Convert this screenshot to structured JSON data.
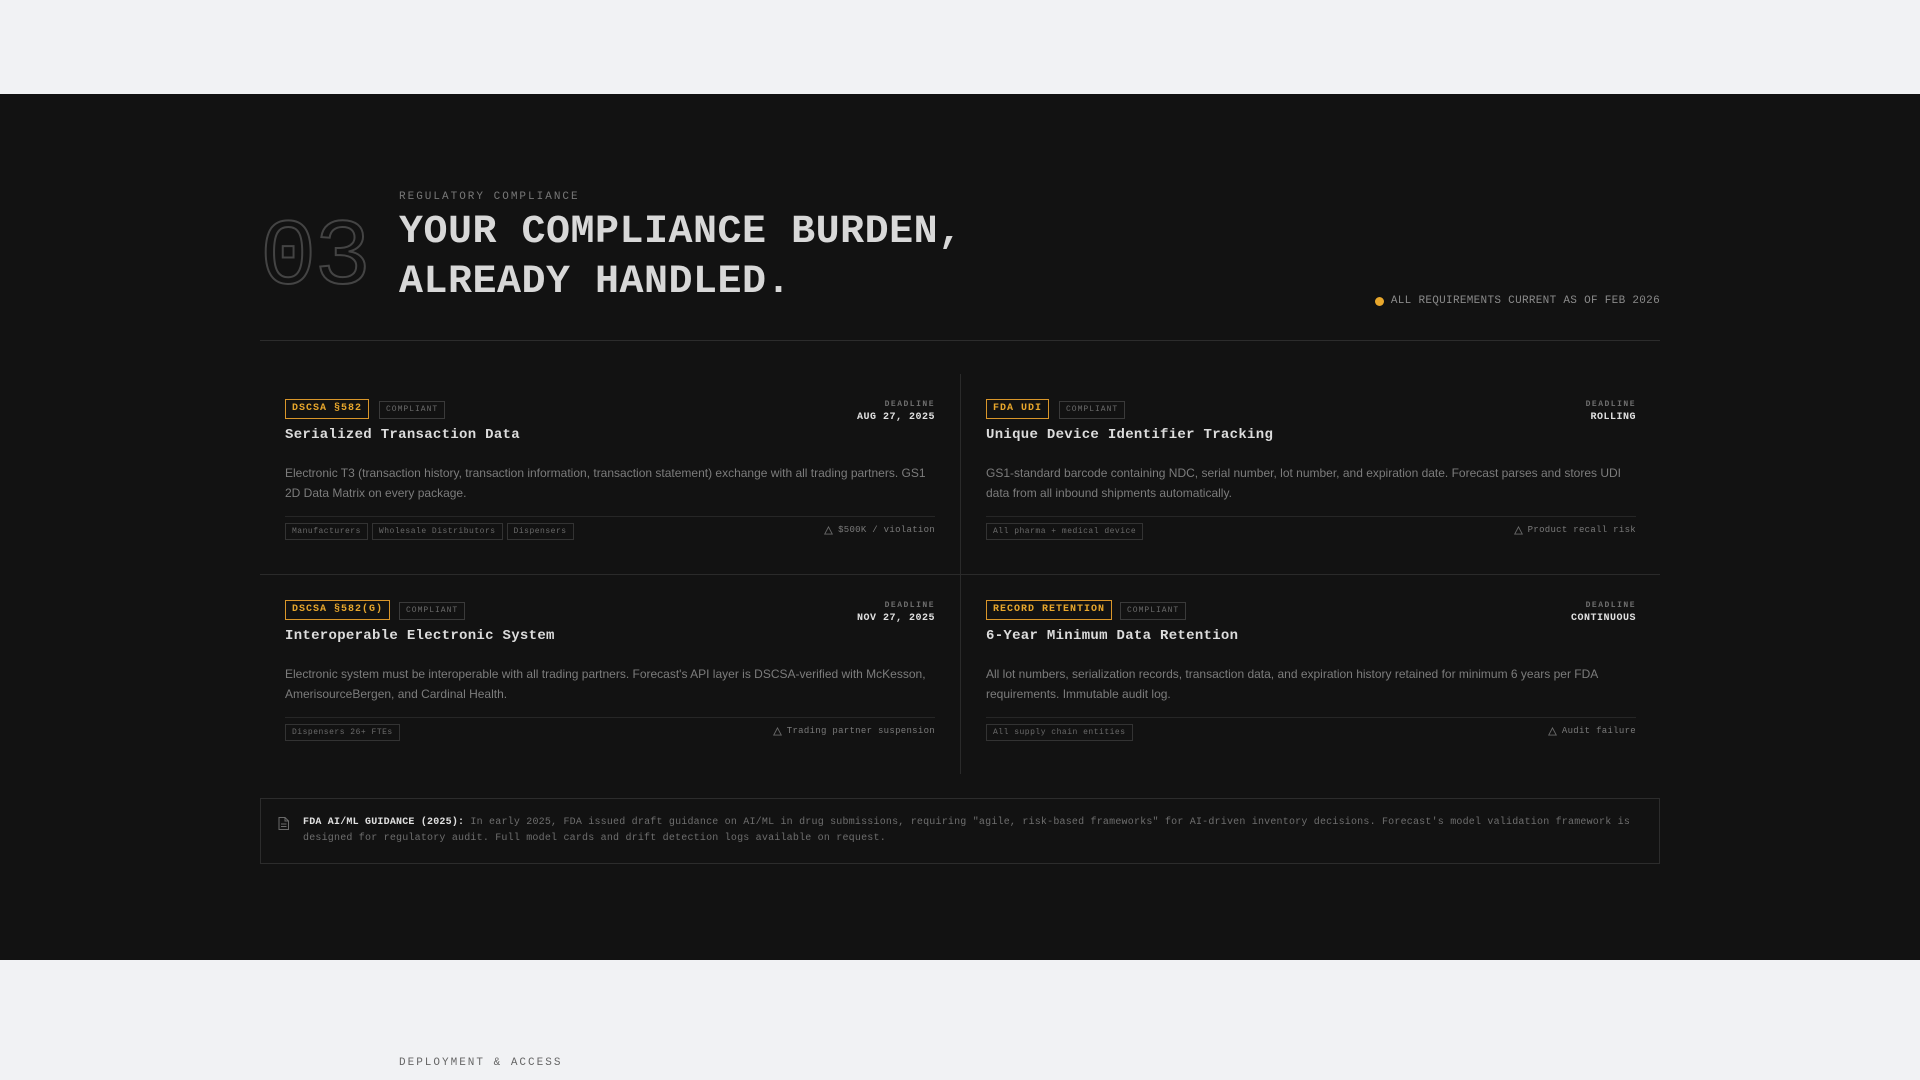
{
  "section": {
    "number": "03",
    "eyebrow": "REGULATORY COMPLIANCE",
    "headline_line1": "YOUR COMPLIANCE BURDEN,",
    "headline_line2": "ALREADY HANDLED.",
    "status_text": "ALL REQUIREMENTS CURRENT AS OF FEB 2026",
    "status_color": "#e8a72c"
  },
  "deadline_label": "DEADLINE",
  "cards": [
    {
      "code": "DSCSA §582",
      "status": "COMPLIANT",
      "deadline": "AUG 27, 2025",
      "title": "Serialized Transaction Data",
      "description": "Electronic T3 (transaction history, transaction information, transaction statement) exchange with all trading partners. GS1 2D Data Matrix on every package.",
      "chips": [
        "Manufacturers",
        "Wholesale Distributors",
        "Dispensers"
      ],
      "risk": "$500K / violation"
    },
    {
      "code": "FDA UDI",
      "status": "COMPLIANT",
      "deadline": "ROLLING",
      "title": "Unique Device Identifier Tracking",
      "description": "GS1-standard barcode containing NDC, serial number, lot number, and expiration date. Forecast parses and stores UDI data from all inbound shipments automatically.",
      "chips": [
        "All pharma + medical device"
      ],
      "risk": "Product recall risk"
    },
    {
      "code": "DSCSA §582(G)",
      "status": "COMPLIANT",
      "deadline": "NOV 27, 2025",
      "title": "Interoperable Electronic System",
      "description": "Electronic system must be interoperable with all trading partners. Forecast's API layer is DSCSA-verified with McKesson, AmerisourceBergen, and Cardinal Health.",
      "chips": [
        "Dispensers 26+ FTEs"
      ],
      "risk": "Trading partner suspension"
    },
    {
      "code": "RECORD RETENTION",
      "status": "COMPLIANT",
      "deadline": "CONTINUOUS",
      "title": "6-Year Minimum Data Retention",
      "description": "All lot numbers, serialization records, transaction data, and expiration history retained for minimum 6 years per FDA requirements. Immutable audit log.",
      "chips": [
        "All supply chain entities"
      ],
      "risk": "Audit failure"
    }
  ],
  "note": {
    "label": "FDA AI/ML GUIDANCE (2025):",
    "text": " In early 2025, FDA issued draft guidance on AI/ML in drug submissions, requiring \"agile, risk-based frameworks\" for AI-driven inventory decisions. Forecast's model validation framework is designed for regulatory audit. Full model cards and drift detection logs available on request."
  },
  "next_section": {
    "eyebrow": "DEPLOYMENT & ACCESS"
  },
  "icons": {
    "risk": "warning-triangle-icon",
    "note": "document-icon"
  }
}
